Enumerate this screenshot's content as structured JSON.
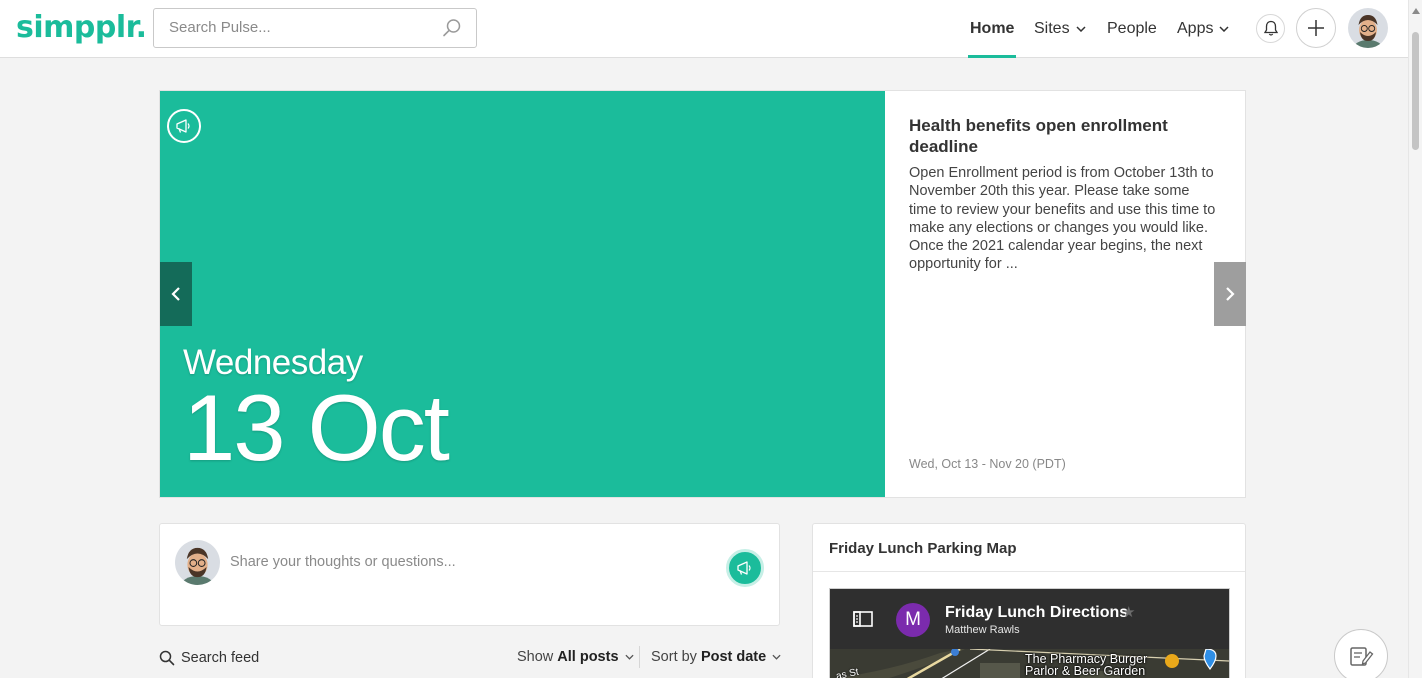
{
  "header": {
    "logo": "simpplr.",
    "search_placeholder": "Search Pulse...",
    "nav": [
      {
        "label": "Home",
        "active": true
      },
      {
        "label": "Sites",
        "dropdown": true
      },
      {
        "label": "People"
      },
      {
        "label": "Apps",
        "dropdown": true
      }
    ],
    "icons": [
      "notification-bell-icon",
      "plus-icon",
      "user-avatar"
    ]
  },
  "carousel": {
    "slide_weekday": "Wednesday",
    "slide_date": "13 Oct",
    "title": "Health benefits open enrollment deadline",
    "body": "Open Enrollment period is from October 13th to November 20th this year. Please take some time to review your benefits and use this time to make any elections or changes you would like. Once the 2021 calendar year begins, the next opportunity for ...",
    "date_range": "Wed, Oct 13 - Nov 20 (PDT)",
    "colors": {
      "slide_bg": "#1bbc9b",
      "prev_bg": "#146b59",
      "next_bg": "#9e9e9e"
    }
  },
  "composer": {
    "placeholder": "Share your thoughts or questions..."
  },
  "feed": {
    "search_label": "Search feed",
    "show_label": "Show",
    "show_value": "All posts",
    "sort_label": "Sort by",
    "sort_value": "Post date"
  },
  "widget": {
    "title": "Friday Lunch Parking Map",
    "map": {
      "initial": "M",
      "title": "Friday Lunch Directions",
      "author": "Matthew Rawls",
      "poi": "The Pharmacy Burger\nParlor & Beer Garden",
      "street": "as St"
    }
  },
  "accent_color": "#1bbc9b"
}
